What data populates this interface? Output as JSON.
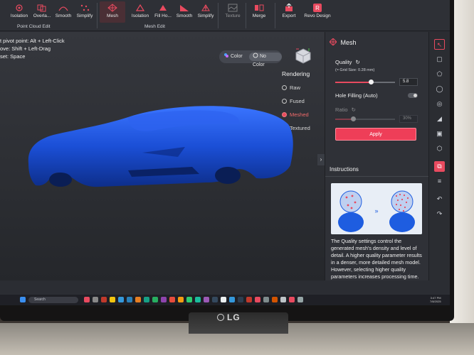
{
  "ribbon": {
    "point_cloud_edit": {
      "title": "Point Cloud Edit",
      "buttons": [
        "Isolation",
        "Overla...",
        "Smooth",
        "Simplify"
      ]
    },
    "mesh_edit": {
      "title": "Mesh Edit",
      "buttons": [
        "Mesh",
        "Isolation",
        "Fill Ho...",
        "Smooth",
        "Simplify"
      ]
    },
    "extra_buttons": [
      "Texture",
      "Merge",
      "Export",
      "Revo Design"
    ]
  },
  "viewport": {
    "hints": [
      "t pivot point: Alt + Left-Click",
      "ove: Shift + Left-Drag",
      "set: Space"
    ],
    "color_toggle": {
      "color": "Color",
      "no_color": "No Color",
      "selected": "No Color"
    },
    "rendering": {
      "title": "Rendering",
      "options": [
        "Raw",
        "Fused",
        "Meshed",
        "Textured"
      ],
      "selected": "Meshed"
    },
    "model_color": "#1b4fd6"
  },
  "panel": {
    "title": "Mesh",
    "quality": {
      "label": "Quality",
      "grid_size": "(≈ Grid Size: 0.28 mm)",
      "value": "5.8",
      "level": 0.6
    },
    "hole_filling": {
      "label": "Hole Filling (Auto)",
      "enabled": false
    },
    "ratio": {
      "label": "Ratio",
      "value": "30%",
      "level": 0.3
    },
    "apply_label": "Apply",
    "instructions_title": "Instructions",
    "instructions_text": "The Quality settings control the generated mesh's density and level of detail. A higher quality parameter results in a denser, more detailed mesh model. However, selecting higher quality parameters increases processing time."
  },
  "taskbar": {
    "search_placeholder": "Search",
    "time": "3:47 PM",
    "date": "7/8/2025"
  },
  "monitor_brand": "LG",
  "colors": {
    "accent": "#e84a5f",
    "model_blue": "#1b4fd6"
  }
}
